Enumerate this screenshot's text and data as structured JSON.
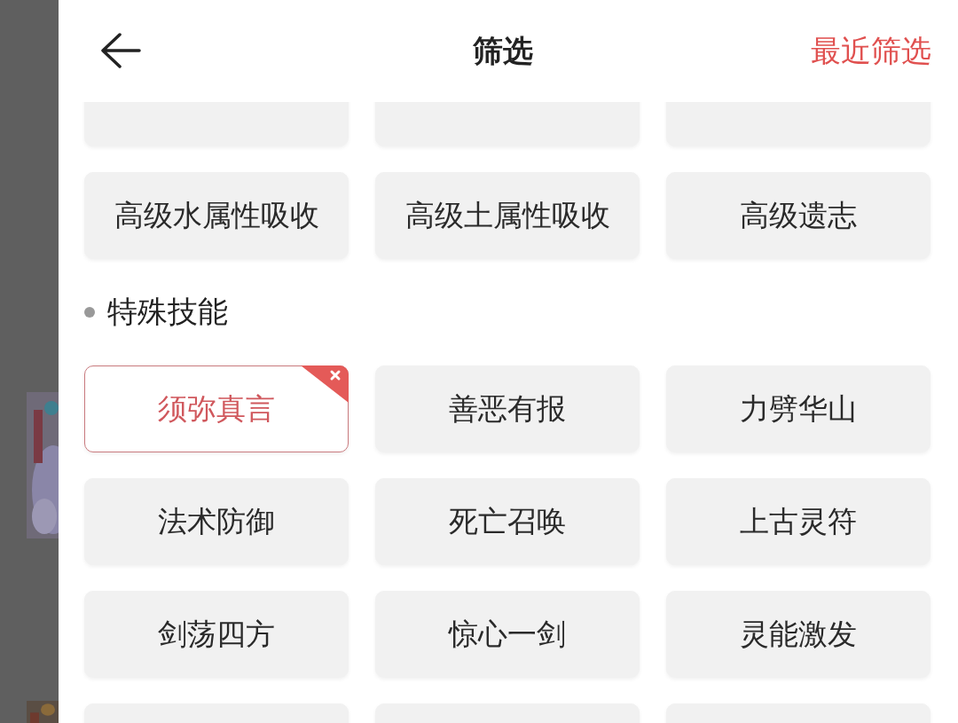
{
  "header": {
    "title": "筛选",
    "recent_link": "最近筛选"
  },
  "sections": [
    {
      "chips": [
        {
          "kind": "cut"
        },
        {
          "kind": "cut"
        },
        {
          "kind": "cut"
        },
        {
          "kind": "chip",
          "label": "高级水属性吸收",
          "selected": false
        },
        {
          "kind": "chip",
          "label": "高级土属性吸收",
          "selected": false
        },
        {
          "kind": "chip",
          "label": "高级遗志",
          "selected": false
        }
      ]
    },
    {
      "title": "特殊技能",
      "chips": [
        {
          "kind": "chip",
          "label": "须弥真言",
          "selected": true
        },
        {
          "kind": "chip",
          "label": "善恶有报",
          "selected": false
        },
        {
          "kind": "chip",
          "label": "力劈华山",
          "selected": false
        },
        {
          "kind": "chip",
          "label": "法术防御",
          "selected": false
        },
        {
          "kind": "chip",
          "label": "死亡召唤",
          "selected": false
        },
        {
          "kind": "chip",
          "label": "上古灵符",
          "selected": false
        },
        {
          "kind": "chip",
          "label": "剑荡四方",
          "selected": false
        },
        {
          "kind": "chip",
          "label": "惊心一剑",
          "selected": false
        },
        {
          "kind": "chip",
          "label": "灵能激发",
          "selected": false
        },
        {
          "kind": "cut"
        },
        {
          "kind": "cut"
        },
        {
          "kind": "cut"
        }
      ]
    }
  ]
}
